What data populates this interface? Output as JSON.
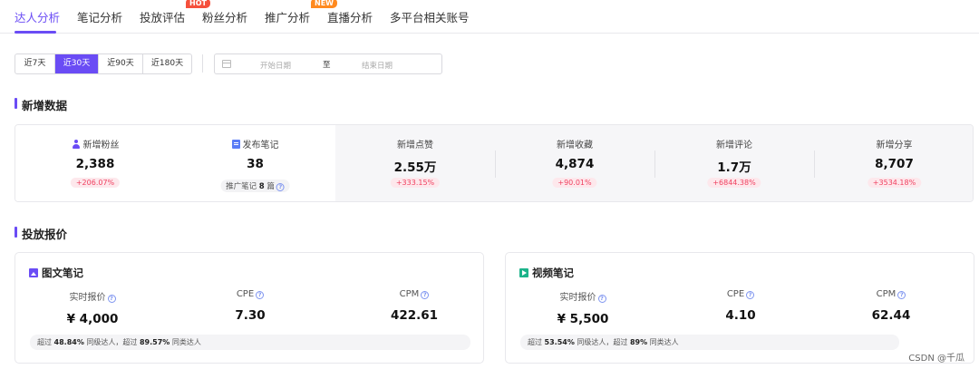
{
  "tabs": [
    {
      "label": "达人分析",
      "badge": ""
    },
    {
      "label": "笔记分析",
      "badge": ""
    },
    {
      "label": "投放评估",
      "badge": "HOT"
    },
    {
      "label": "粉丝分析",
      "badge": ""
    },
    {
      "label": "推广分析",
      "badge": "NEW"
    },
    {
      "label": "直播分析",
      "badge": ""
    },
    {
      "label": "多平台相关账号",
      "badge": ""
    }
  ],
  "date_filter": {
    "ranges": [
      "近7天",
      "近30天",
      "近90天",
      "近180天"
    ],
    "selected": "近30天",
    "start_placeholder": "开始日期",
    "separator": "至",
    "end_placeholder": "结束日期"
  },
  "new_data": {
    "title": "新增数据",
    "stats": [
      {
        "label": "新增粉丝",
        "value": "2,388",
        "change": "+206.07%",
        "icon": "user-icon"
      },
      {
        "label": "发布笔记",
        "value": "38",
        "sub_prefix": "推广笔记",
        "sub_value": "8",
        "sub_suffix": "篇",
        "icon": "note-icon"
      },
      {
        "label": "新增点赞",
        "value": "2.55万",
        "change": "+333.15%"
      },
      {
        "label": "新增收藏",
        "value": "4,874",
        "change": "+90.01%"
      },
      {
        "label": "新增评论",
        "value": "1.7万",
        "change": "+6844.38%"
      },
      {
        "label": "新增分享",
        "value": "8,707",
        "change": "+3534.18%"
      }
    ]
  },
  "pricing": {
    "title": "投放报价",
    "cards": [
      {
        "title": "图文笔记",
        "icon": "image-icon",
        "metrics": [
          {
            "label": "实时报价",
            "value": "¥ 4,000"
          },
          {
            "label": "CPE",
            "value": "7.30"
          },
          {
            "label": "CPM",
            "value": "422.61"
          }
        ],
        "foot": {
          "p1": "超过 ",
          "v1": "48.84%",
          "p2": " 同级达人，超过 ",
          "v2": "89.57%",
          "p3": " 同类达人"
        }
      },
      {
        "title": "视频笔记",
        "icon": "video-icon",
        "metrics": [
          {
            "label": "实时报价",
            "value": "¥ 5,500"
          },
          {
            "label": "CPE",
            "value": "4.10"
          },
          {
            "label": "CPM",
            "value": "62.44"
          }
        ],
        "foot": {
          "p1": "超过 ",
          "v1": "53.54%",
          "p2": " 同级达人，超过 ",
          "v2": "89%",
          "p3": " 同类达人"
        }
      }
    ]
  },
  "watermark": "CSDN @千瓜",
  "colors": {
    "accent": "#6a4cf5",
    "hot_badge": "#f5503c",
    "new_badge": "#ff8a1f",
    "negative": "#f03f5f",
    "video": "#1cb38a"
  }
}
